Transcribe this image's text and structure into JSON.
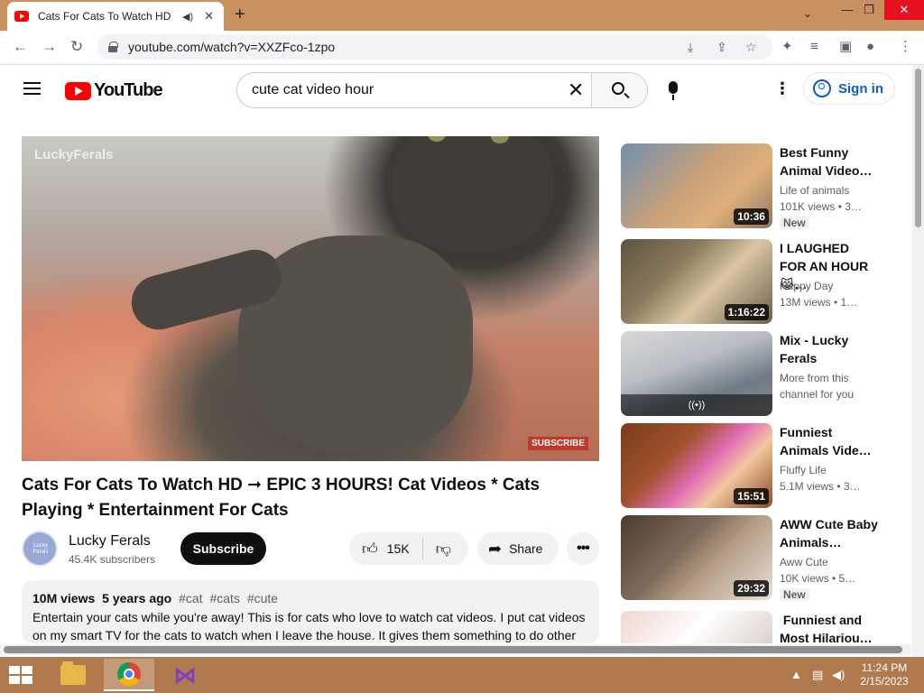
{
  "browser": {
    "tab_title": "Cats For Cats To Watch HD -",
    "tab_audio_icon": "speaker-icon",
    "tab_close": "✕",
    "new_tab": "+",
    "url": "youtube.com/watch?v=XXZFco-1zpo",
    "window_controls": {
      "minimize": "—",
      "restore": "❐",
      "close": "✕"
    }
  },
  "masthead": {
    "logo_text": "YouTube",
    "search_value": "cute cat video hour",
    "search_placeholder": "Search",
    "signin_label": "Sign in"
  },
  "player": {
    "watermark": "LuckyFerals",
    "subscribe_overlay": "SUBSCRIBE"
  },
  "video": {
    "title": "Cats For Cats To Watch HD ➞ EPIC 3 HOURS! Cat Videos * Cats Playing * Entertainment For Cats",
    "channel_name": "Lucky Ferals",
    "channel_subscribers": "45.4K subscribers",
    "subscribe_label": "Subscribe",
    "like_count": "15K",
    "share_label": "Share",
    "more_label": "•••",
    "views": "10M views",
    "age": "5 years ago",
    "tags": [
      "#cat",
      "#cats",
      "#cute"
    ],
    "description": "Entertain your cats while you're away! This is for cats who love to watch cat videos. I put cat videos on my smart TV for the cats to watch when I leave the house. It gives them something to do other"
  },
  "recommendations": [
    {
      "title": "Best Funny Animal Video…",
      "channel": "Life of animals",
      "meta": "101K views  • 3…",
      "duration": "10:36",
      "badge": "New",
      "thumb_colors": [
        "#c7a17b",
        "#6f8fae"
      ]
    },
    {
      "title": "I LAUGHED FOR AN HOUR😹…",
      "channel": "Happy Day",
      "meta": "13M views  • 1…",
      "duration": "1:16:22",
      "badge": "",
      "thumb_colors": [
        "#8a7a5c",
        "#d9c7a4"
      ]
    },
    {
      "title": "Mix - Lucky Ferals",
      "channel": "More from this",
      "meta": "channel for you",
      "duration": "",
      "badge": "",
      "mix_icon": "((•))",
      "thumb_colors": [
        "#6e7a86",
        "#b9bec4"
      ]
    },
    {
      "title": "Funniest Animals Vide…",
      "channel": "Fluffy Life",
      "meta": "5.1M views  • 3…",
      "duration": "15:51",
      "badge": "",
      "thumb_colors": [
        "#a0522d",
        "#e46fb4"
      ]
    },
    {
      "title": "AWW Cute Baby Animals…",
      "channel": "Aww Cute",
      "meta": "10K views  • 5…",
      "duration": "29:32",
      "badge": "New",
      "thumb_colors": [
        "#7d6b5a",
        "#e7e1da"
      ]
    },
    {
      "title": "󠁧 Funniest and Most Hilariou…",
      "channel": "",
      "meta": "",
      "duration": "",
      "badge": "",
      "thumb_colors": [
        "#f0d6d0",
        "#c9b8b0"
      ]
    }
  ],
  "taskbar": {
    "time": "11:24 PM",
    "date": "2/15/2023"
  }
}
